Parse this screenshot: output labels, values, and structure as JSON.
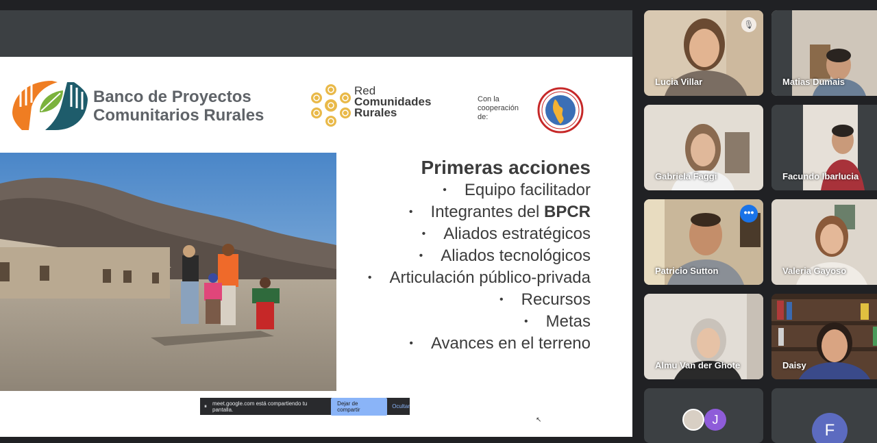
{
  "slide": {
    "bpcr_line1": "Banco de Proyectos",
    "bpcr_line2": "Comunitarios Rurales",
    "red_line1": "Red",
    "red_line2": "Comunidades",
    "red_line3": "Rurales",
    "coop_line1": "Con la",
    "coop_line2": "cooperación",
    "coop_line3": "de:",
    "heading": "Primeras acciones",
    "bullets": [
      {
        "text": "Equipo facilitador"
      },
      {
        "text": "Integrantes del ",
        "bold": "BPCR"
      },
      {
        "text": "Aliados estratégicos"
      },
      {
        "text": "Aliados tecnológicos"
      },
      {
        "text": "Articulación público-privada"
      },
      {
        "text": "Recursos"
      },
      {
        "text": "Metas"
      },
      {
        "text": "Avances en el terreno"
      }
    ],
    "bullet_char": "•"
  },
  "share_bar": {
    "message": "meet.google.com está compartiendo tu pantalla.",
    "stop_label": "Dejar de compartir",
    "hide_label": "Ocultar"
  },
  "participants": [
    {
      "name": "Lucia Villar"
    },
    {
      "name": "Matias Dumais"
    },
    {
      "name": "Gabriela Faggi"
    },
    {
      "name": "Facundo Ibarlucia"
    },
    {
      "name": "Patricio Sutton"
    },
    {
      "name": "Valeria Gayoso"
    },
    {
      "name": "Almu Van der Ghote"
    },
    {
      "name": "Daisy"
    }
  ],
  "avatars": {
    "initial_j": "J",
    "initial_f": "F",
    "color_j": "#8e5cd9",
    "color_f": "#5c6bc0"
  },
  "icons": {
    "mic_off": "🎙",
    "more": "•••",
    "pause": "⏸",
    "cursor": "↖"
  },
  "colors": {
    "accent": "#8ab4f8",
    "background": "#202124"
  }
}
